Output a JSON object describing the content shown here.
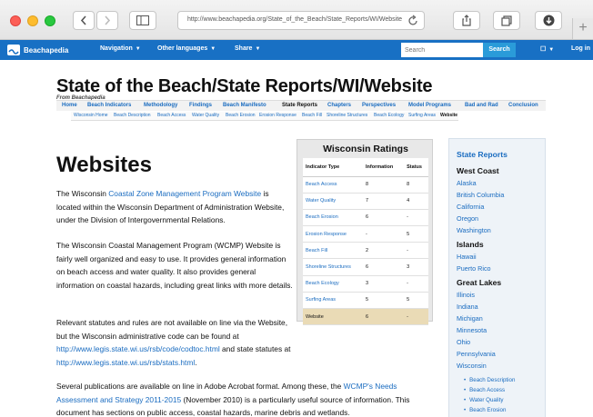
{
  "browser": {
    "url": "http://www.beachapedia.org/State_of_the_Beach/State_Reports/WI/Website",
    "new_tab": "+"
  },
  "sitenav": {
    "brand": "Beachapedia",
    "items": [
      "Navigation",
      "Other languages",
      "Share"
    ],
    "search_placeholder": "Search",
    "search_button": "Search",
    "login": "Log in",
    "box": "☐"
  },
  "page": {
    "title": "State of the Beach/State Reports/WI/Website",
    "from": "From Beachapedia",
    "tabs": [
      "Home",
      "Beach Indicators",
      "Methodology",
      "Findings",
      "Beach Manifesto",
      "State Reports",
      "Chapters",
      "Perspectives",
      "Model Programs",
      "Bad and Rad",
      "Conclusion"
    ],
    "subtabs": [
      "Wisconsin Home",
      "Beach Description",
      "Beach Access",
      "Water Quality",
      "Beach Erosion",
      "Erosion Response",
      "Beach Fill",
      "Shoreline Structures",
      "Beach Ecology",
      "Surfing Areas",
      "Website"
    ],
    "heading": "Websites",
    "p1": {
      "before": "The Wisconsin ",
      "link": "Coastal Zone Management Program Website",
      "after": " is located within the Wisconsin Department of Administration Website, under the Division of Intergovernmental Relations."
    },
    "p2": "The Wisconsin Coastal Management Program (WCMP) Website is fairly well organized and easy to use. It provides general information on beach access and water quality. It also provides general information on coastal hazards, including great links with more details.",
    "p3": {
      "before": "Relevant statutes and rules are not available on line via the Website, but the Wisconsin administrative code can be found at ",
      "link1": "http://www.legis.state.wi.us/rsb/code/codtoc.html",
      "middle": " and state statutes at ",
      "link2": "http://www.legis.state.wi.us/rsb/stats.html",
      "after": "."
    },
    "p4": {
      "before": "Several publications are available on line in Adobe Acrobat format. Among these, the ",
      "link": "WCMP's Needs Assessment and Strategy 2011-2015",
      "after": " (November 2010) is a particularly useful source of information. This document has sections on public access, coastal hazards, marine debris and wetlands."
    }
  },
  "ratings": {
    "title": "Wisconsin Ratings",
    "headers": [
      "Indicator Type",
      "Information",
      "Status"
    ],
    "rows": [
      [
        "Beach Access",
        "8",
        "8"
      ],
      [
        "Water Quality",
        "7",
        "4"
      ],
      [
        "Beach Erosion",
        "6",
        "-"
      ],
      [
        "Erosion Response",
        "-",
        "5"
      ],
      [
        "Beach Fill",
        "2",
        "-"
      ],
      [
        "Shoreline Structures",
        "6",
        "3"
      ],
      [
        "Beach Ecology",
        "3",
        "-"
      ],
      [
        "Surfing Areas",
        "5",
        "5"
      ],
      [
        "Website",
        "6",
        "-"
      ]
    ],
    "highlight_color": "#eadbb6"
  },
  "sidebar": {
    "title": "State Reports",
    "west_coast": "West Coast",
    "west_items": [
      "Alaska",
      "British Columbia",
      "California",
      "Oregon",
      "Washington"
    ],
    "islands": "Islands",
    "island_items": [
      "Hawaii",
      "Puerto Rico"
    ],
    "great_lakes": "Great Lakes",
    "lakes_items": [
      "Illinois",
      "Indiana",
      "Michigan",
      "Minnesota",
      "Ohio",
      "Pennsylvania",
      "Wisconsin"
    ],
    "wisconsin_sub": [
      "Beach Description",
      "Beach Access",
      "Water Quality",
      "Beach Erosion"
    ]
  },
  "colors": {
    "nav_blue": "#1870c4",
    "link_blue": "#1a6cc0",
    "search_button": "#2a9bd9"
  }
}
